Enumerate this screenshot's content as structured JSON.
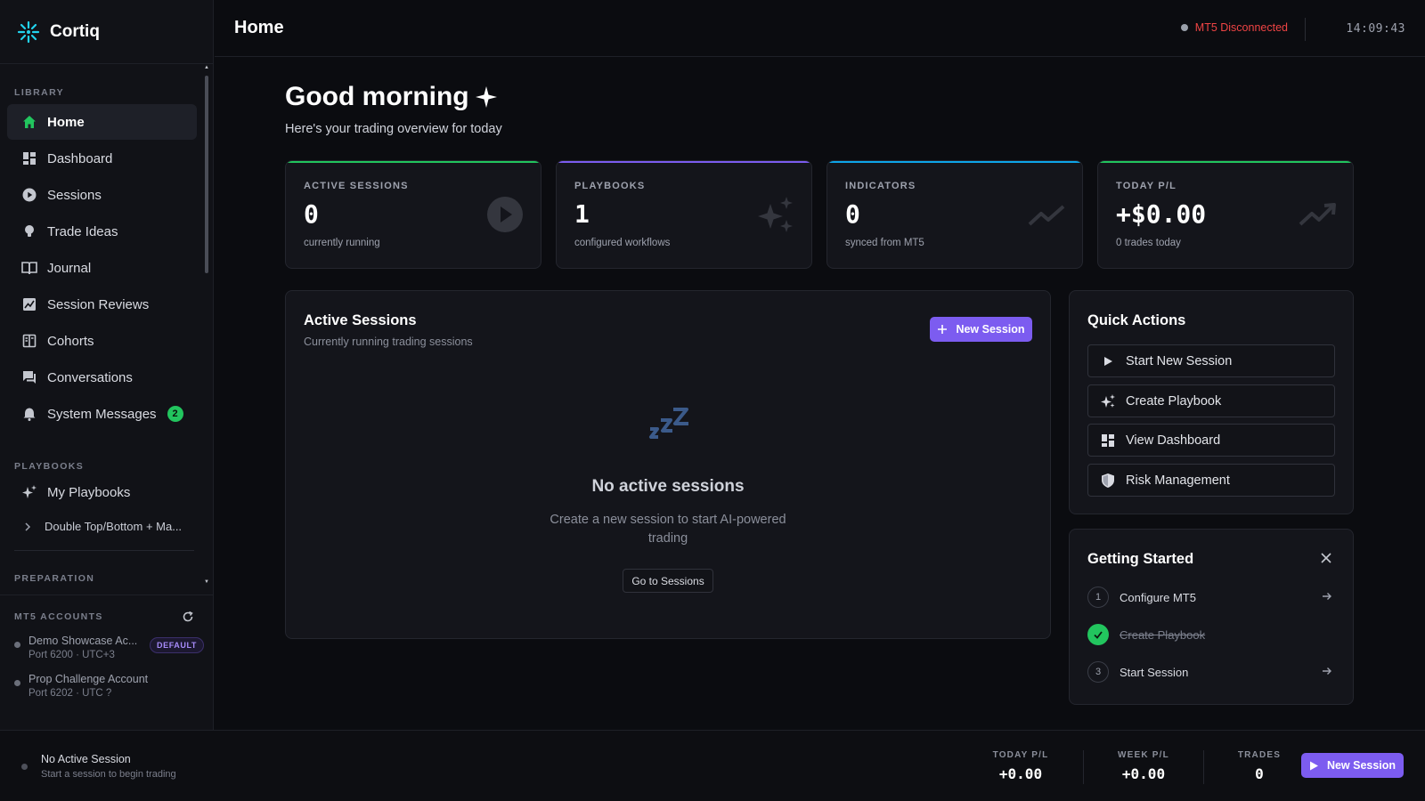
{
  "app": {
    "name": "Cortiq"
  },
  "sidebar": {
    "library_label": "LIBRARY",
    "items": [
      {
        "label": "Home",
        "icon": "home-icon"
      },
      {
        "label": "Dashboard",
        "icon": "dashboard-icon"
      },
      {
        "label": "Sessions",
        "icon": "play-circle-icon"
      },
      {
        "label": "Trade Ideas",
        "icon": "lightbulb-icon"
      },
      {
        "label": "Journal",
        "icon": "book-icon"
      },
      {
        "label": "Session Reviews",
        "icon": "chart-review-icon"
      },
      {
        "label": "Cohorts",
        "icon": "cohorts-icon"
      },
      {
        "label": "Conversations",
        "icon": "chat-icon"
      },
      {
        "label": "System Messages",
        "icon": "bell-icon",
        "badge": "2"
      }
    ],
    "playbooks_label": "PLAYBOOKS",
    "my_playbooks": "My Playbooks",
    "playbook_sub": "Double Top/Bottom + Ma...",
    "cut_label": "PREPARATION",
    "mt5_label": "MT5 ACCOUNTS",
    "accounts": [
      {
        "name": "Demo Showcase Ac...",
        "sub": "Port 6200 · UTC+3",
        "badge": "DEFAULT"
      },
      {
        "name": "Prop Challenge Account",
        "sub": "Port 6202 · UTC ?"
      }
    ]
  },
  "header": {
    "title": "Home",
    "mt5_status": "MT5 Disconnected",
    "clock": "14:09:43"
  },
  "greeting": {
    "title": "Good morning",
    "subtitle": "Here's your trading overview for today"
  },
  "stats": [
    {
      "label": "ACTIVE SESSIONS",
      "value": "0",
      "sub": "currently running",
      "accent": "#22c55e"
    },
    {
      "label": "PLAYBOOKS",
      "value": "1",
      "sub": "configured workflows",
      "accent": "#7c5cf0"
    },
    {
      "label": "INDICATORS",
      "value": "0",
      "sub": "synced from MT5",
      "accent": "#0ea5e9"
    },
    {
      "label": "TODAY P/L",
      "value": "+$0.00",
      "sub": "0 trades today",
      "accent": "#22c55e"
    }
  ],
  "active_sessions": {
    "title": "Active Sessions",
    "subtitle": "Currently running trading sessions",
    "new_button": "New Session",
    "empty_title": "No active sessions",
    "empty_line1": "Create a new session to start AI-powered",
    "empty_line2": "trading",
    "goto_button": "Go to Sessions"
  },
  "quick_actions": {
    "title": "Quick Actions",
    "items": [
      {
        "label": "Start New Session",
        "icon": "play-icon"
      },
      {
        "label": "Create Playbook",
        "icon": "sparkle-icon"
      },
      {
        "label": "View Dashboard",
        "icon": "dashboard-icon"
      },
      {
        "label": "Risk Management",
        "icon": "shield-icon"
      }
    ]
  },
  "getting_started": {
    "title": "Getting Started",
    "steps": [
      {
        "num": "1",
        "label": "Configure MT5",
        "done": false
      },
      {
        "num": "",
        "label": "Create Playbook",
        "done": true
      },
      {
        "num": "3",
        "label": "Start Session",
        "done": false
      }
    ]
  },
  "footer": {
    "session_title": "No Active Session",
    "session_sub": "Start a session to begin trading",
    "today_pl_label": "TODAY P/L",
    "today_pl": "+0.00",
    "week_pl_label": "WEEK P/L",
    "week_pl": "+0.00",
    "trades_label": "TRADES",
    "trades": "0",
    "new_button": "New Session"
  },
  "colors": {
    "accent": "#7c5cf0",
    "success": "#22c55e",
    "danger": "#ef4444",
    "info": "#0ea5e9"
  }
}
